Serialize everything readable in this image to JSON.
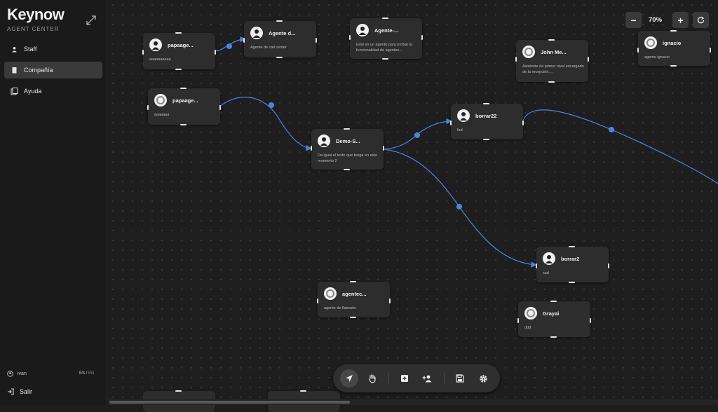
{
  "sidebar": {
    "brand": "Keynow",
    "subtitle": "AGENT CENTER",
    "items": [
      {
        "label": "Staff",
        "icon": "person-icon"
      },
      {
        "label": "Compañía",
        "icon": "building-icon"
      },
      {
        "label": "Ayuda",
        "icon": "book-icon"
      }
    ],
    "user": "ivan",
    "lang_es": "ES /",
    "lang_en": "EN",
    "logout": "Salir"
  },
  "zoom": {
    "minus": "−",
    "value": "70%",
    "plus": "+",
    "reset_icon": "reset-icon"
  },
  "nodes": [
    {
      "name": "papaage...",
      "desc": "aaaaaaaaaa"
    },
    {
      "name": "Agente d...",
      "desc": "Agente de call center"
    },
    {
      "name": "Agente-...",
      "desc": "Este es un agente para probar la funcionalidad de agentes..."
    },
    {
      "name": "John Me...",
      "desc": "Asistente de primer nivel encargado de la recepción,..."
    },
    {
      "name": "ignacio",
      "desc": "agente ignacio"
    },
    {
      "name": "papaage...",
      "desc": "aaaaaaa"
    },
    {
      "name": "Demo-S...",
      "desc": "Da igual el texto que tenga en este momento 2"
    },
    {
      "name": "borrar22",
      "desc": "fad"
    },
    {
      "name": "borrar2",
      "desc": "sad"
    },
    {
      "name": "agentec...",
      "desc": "agente de llamada"
    },
    {
      "name": "Grayai",
      "desc": "ddd"
    }
  ],
  "toolbar": [
    "navigate-icon",
    "hand-icon",
    "add-node-icon",
    "add-user-icon",
    "save-icon",
    "settings-icon"
  ],
  "colors": {
    "edge": "#4a86e0",
    "canvas": "#1e1e1e",
    "node": "#2d2d2d"
  }
}
